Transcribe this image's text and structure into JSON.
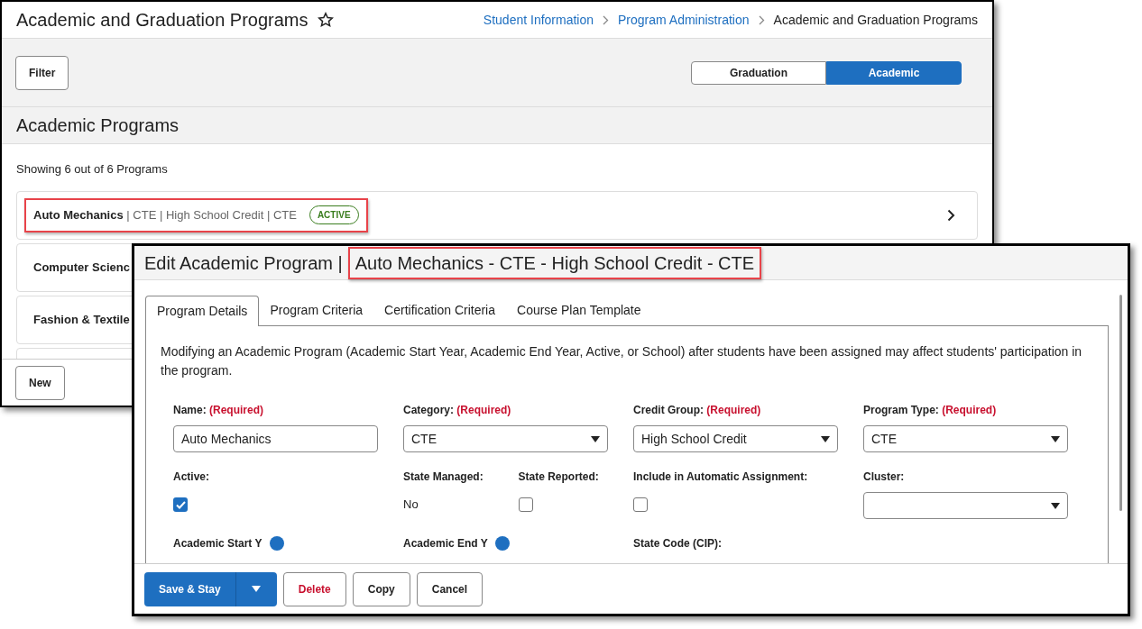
{
  "back_window": {
    "title": "Academic and Graduation Programs",
    "breadcrumbs": [
      "Student Information",
      "Program Administration",
      "Academic and Graduation Programs"
    ],
    "filter_button": "Filter",
    "view_toggle": [
      {
        "label": "Graduation",
        "selected": false
      },
      {
        "label": "Academic",
        "selected": true
      }
    ],
    "section_title": "Academic Programs",
    "count_text": "Showing 6 out of 6 Programs",
    "programs": [
      {
        "name": "Auto Mechanics",
        "details": "| CTE | High School Credit | CTE",
        "badge": "ACTIVE",
        "highlighted": true
      },
      {
        "name": "Computer Scienc",
        "highlighted": false
      },
      {
        "name": "Fashion & Textile",
        "highlighted": false
      },
      {
        "highlighted": false
      }
    ],
    "new_button": "New"
  },
  "edit_window": {
    "title": "Edit Academic Program |",
    "title_highlight": "Auto Mechanics - CTE - High School Credit - CTE",
    "tabs": [
      {
        "label": "Program Details",
        "selected": true
      },
      {
        "label": "Program Criteria",
        "selected": false
      },
      {
        "label": "Certification Criteria",
        "selected": false
      },
      {
        "label": "Course Plan Template",
        "selected": false
      }
    ],
    "notice": "Modifying an Academic Program (Academic Start Year, Academic End Year, Active, or School) after students have been assigned may affect students' participation in the program.",
    "rows": [
      [
        {
          "kind": "text",
          "label": "Name:",
          "required": "(Required)",
          "value": "Auto Mechanics"
        },
        {
          "kind": "select",
          "label": "Category:",
          "required": "(Required)",
          "value": "CTE"
        },
        {
          "kind": "select",
          "label": "Credit Group:",
          "required": "(Required)",
          "value": "High School Credit"
        },
        {
          "kind": "select",
          "label": "Program Type:",
          "required": "(Required)",
          "value": "CTE"
        }
      ],
      [
        {
          "kind": "checkbox",
          "label": "Active:",
          "checked": true
        },
        {
          "kind": "group",
          "items": [
            {
              "kind": "static",
              "label": "State Managed:",
              "value": "No"
            },
            {
              "kind": "checkbox",
              "label": "State Reported:",
              "checked": false
            }
          ]
        },
        {
          "kind": "checkbox",
          "label": "Include in Automatic Assignment:",
          "checked": false
        },
        {
          "kind": "select",
          "label": "Cluster:"
        }
      ],
      [
        {
          "kind": "label",
          "label": "Academic Start Y",
          "info": true
        },
        {
          "kind": "label",
          "label": "Academic End Y",
          "info": true
        },
        {
          "kind": "label",
          "label": "State Code (CIP):"
        }
      ]
    ],
    "buttons": [
      {
        "kind": "primary",
        "label": "Save & Stay"
      },
      {
        "kind": "danger",
        "label": "Delete"
      },
      {
        "kind": "plain",
        "label": "Copy"
      },
      {
        "kind": "plain",
        "label": "Cancel"
      }
    ]
  }
}
